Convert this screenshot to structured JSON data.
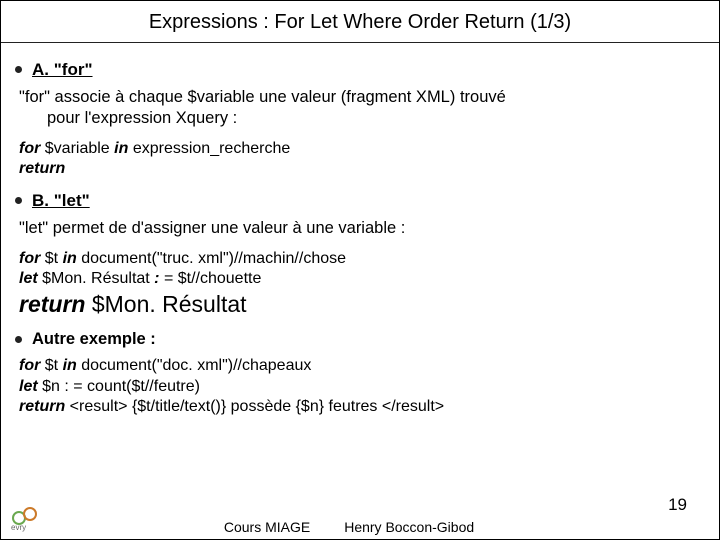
{
  "title": "Expressions : For Let Where Order Return (1/3)",
  "sections": {
    "a": {
      "heading": "A. \"for\"",
      "para_lead": "\"for\" associe à chaque $variable une valeur (fragment XML) trouvé",
      "para_indent": "pour l'expression Xquery :",
      "code": {
        "for": "for",
        "var": " $variable ",
        "in": "in",
        "expr": " expression_recherche",
        "ret": "return"
      }
    },
    "b": {
      "heading": "B. \"let\"",
      "para": "\"let\" permet de d'assigner une valeur à une variable :",
      "code": {
        "l1a": "for",
        "l1b": " $t ",
        "l1c": "in",
        "l1d": " document(\"truc. xml\")//machin//chose",
        "l2a": "let",
        "l2b": " $Mon. Résultat ",
        "l2c": ":",
        "l2d": " = $t//chouette",
        "l3a": "return",
        "l3b": " $Mon. Résultat"
      }
    },
    "c": {
      "heading": "Autre exemple :",
      "code": {
        "l1a": "for",
        "l1b": " $t ",
        "l1c": "in",
        "l1d": " document(\"doc. xml\")//chapeaux",
        "l2a": "let",
        "l2b": " $n : = count($t//feutre)",
        "l3a": "return",
        "l3b": " <result> {$t/title/text()} possède {$n} feutres </result>"
      }
    }
  },
  "footer": {
    "left": "Cours MIAGE",
    "right": "Henry Boccon-Gibod",
    "page": "19",
    "logo_label": "evry"
  }
}
